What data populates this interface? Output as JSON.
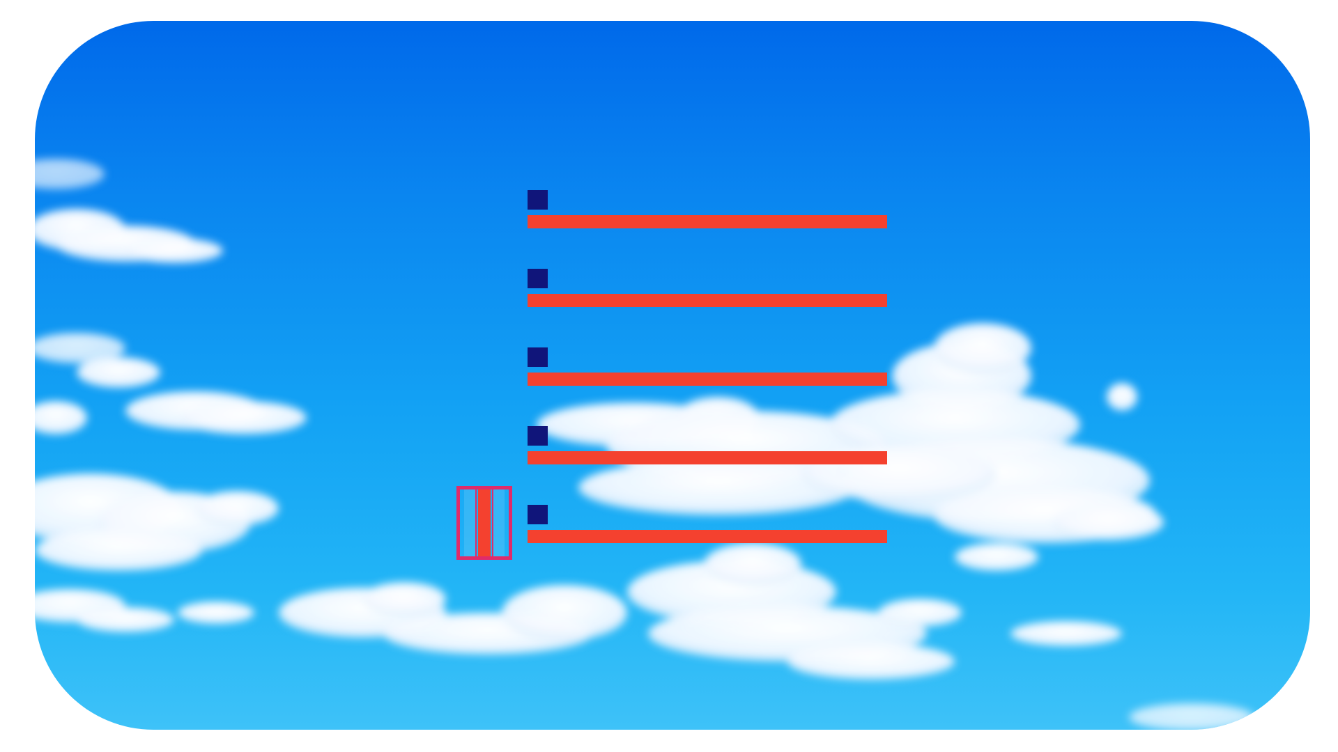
{
  "background": {
    "scene": "sky-with-clouds",
    "sky_top_color": "#0069ea",
    "sky_bottom_color": "#3ec2f8",
    "cloud_color": "#ffffff"
  },
  "list": {
    "marker_color": "#10157a",
    "bar_color": "#f4412f",
    "items": [
      {
        "marker": "square-icon"
      },
      {
        "marker": "square-icon"
      },
      {
        "marker": "square-icon"
      },
      {
        "marker": "square-icon"
      },
      {
        "marker": "square-icon"
      }
    ]
  },
  "control": {
    "icon": "pause-icon",
    "border_color": "#e02b6a",
    "fill_color": "#f4412f"
  }
}
